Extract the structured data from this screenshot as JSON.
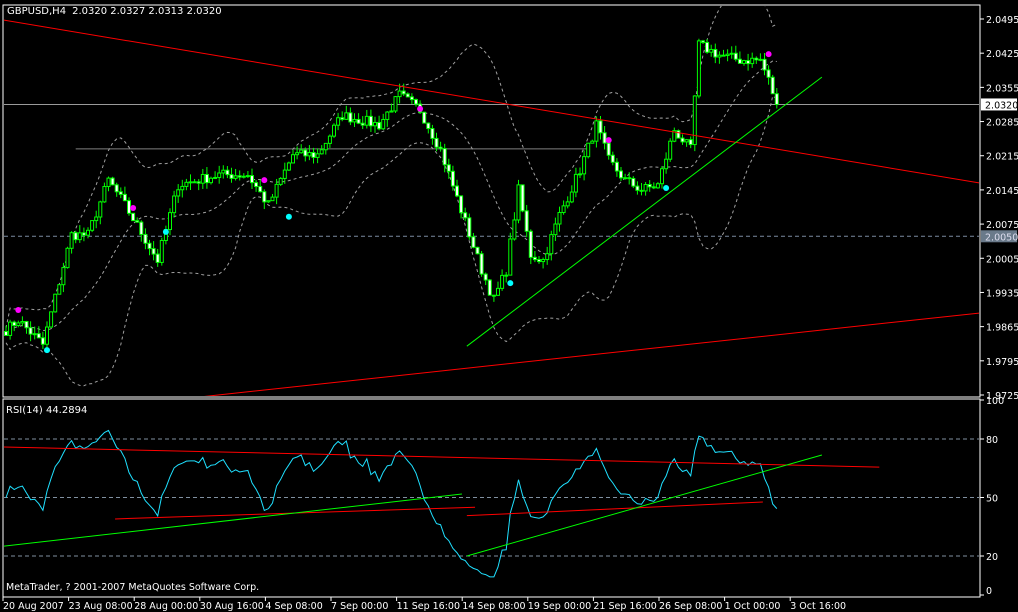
{
  "header": {
    "symbol": "GBPUSD,H4",
    "ohlc": "2.0320 2.0327 2.0313 2.0320"
  },
  "rsi_label": "RSI(14) 44.2894",
  "copyright": "MetaTrader, ? 2001-2007 MetaQuotes Software Corp.",
  "colors": {
    "background": "#000000",
    "candle": "#00ff00",
    "bear_body": "#ffffff",
    "band": "#a0a0a0",
    "trend_red": "#ff0000",
    "trend_green": "#00ff00",
    "rsi": "#1fe0ff",
    "fractal_up": "#ff00ff",
    "fractal_down": "#00ffff",
    "grid": "#8090a0"
  },
  "chart_data": [
    {
      "type": "candlestick",
      "title": "GBPUSD,H4",
      "bar_count": 189,
      "ylim": [
        1.9725,
        2.0495
      ],
      "y_ticks": [
        "2.0495",
        "2.0425",
        "2.0355",
        "2.0285",
        "2.0215",
        "2.0145",
        "2.0075",
        "2.0005",
        "1.9935",
        "1.9865",
        "1.9795",
        "1.9725"
      ],
      "current_price": "2.0320",
      "marked_level": "2.0050",
      "x_labels": [
        "20 Aug 2007",
        "23 Aug 08:00",
        "28 Aug 00:00",
        "30 Aug 16:00",
        "4 Sep 08:00",
        "7 Sep 00:00",
        "11 Sep 16:00",
        "14 Sep 08:00",
        "19 Sep 00:00",
        "21 Sep 16:00",
        "26 Sep 08:00",
        "1 Oct 00:00",
        "3 Oct 16:00"
      ],
      "x_label_bar_step": 16,
      "close_path": [
        [
          0,
          1.9858
        ],
        [
          3,
          1.9879
        ],
        [
          9,
          1.9828
        ],
        [
          16,
          2.0053
        ],
        [
          20,
          2.0053
        ],
        [
          25,
          2.0165
        ],
        [
          29,
          2.0114
        ],
        [
          37,
          2.0001
        ],
        [
          42,
          2.0155
        ],
        [
          52,
          2.0176
        ],
        [
          59,
          2.0176
        ],
        [
          64,
          2.0114
        ],
        [
          70,
          2.0217
        ],
        [
          76,
          2.0217
        ],
        [
          82,
          2.0298
        ],
        [
          91,
          2.0278
        ],
        [
          96,
          2.0339
        ],
        [
          101,
          2.0309
        ],
        [
          106,
          2.0227
        ],
        [
          111,
          2.0104
        ],
        [
          116,
          1.9981
        ],
        [
          119,
          1.992
        ],
        [
          122,
          1.9981
        ],
        [
          125,
          2.0145
        ],
        [
          128,
          2.0012
        ],
        [
          131,
          2.0001
        ],
        [
          135,
          2.0094
        ],
        [
          140,
          2.0186
        ],
        [
          144,
          2.0278
        ],
        [
          147,
          2.0206
        ],
        [
          151,
          2.0165
        ],
        [
          155,
          2.0145
        ],
        [
          159,
          2.0155
        ],
        [
          163,
          2.0268
        ],
        [
          167,
          2.0227
        ],
        [
          169,
          2.0442
        ],
        [
          174,
          2.0421
        ],
        [
          179,
          2.0411
        ],
        [
          184,
          2.0411
        ],
        [
          186,
          2.037
        ],
        [
          188,
          2.032
        ]
      ],
      "bollinger": {
        "period": 20,
        "deviations": 2
      },
      "fractals_up": [
        [
          3,
          1.9899
        ],
        [
          31,
          2.0108
        ],
        [
          63,
          2.0165
        ],
        [
          101,
          2.0311
        ],
        [
          147,
          2.0247
        ],
        [
          186,
          2.0423
        ]
      ],
      "fractals_down": [
        [
          10,
          1.9817
        ],
        [
          39,
          2.0059
        ],
        [
          69,
          2.009
        ],
        [
          123,
          1.9954
        ],
        [
          161,
          2.0149
        ]
      ],
      "trendlines": [
        {
          "color": "red",
          "from": [
            -0.7,
            2.0493
          ],
          "to": [
            237.6,
            2.0159
          ]
        },
        {
          "color": "red",
          "from": [
            47.3,
            1.9721
          ],
          "to": [
            237.6,
            1.9893
          ]
        },
        {
          "color": "green",
          "from": [
            112.4,
            1.9825
          ],
          "to": [
            199,
            2.0376
          ]
        }
      ],
      "hline_segment": {
        "from_bar": 17,
        "to_bar": 142,
        "price": 2.0229
      }
    },
    {
      "type": "line",
      "title": "RSI(14)",
      "last_value": 44.2894,
      "ylim": [
        0,
        100
      ],
      "y_ticks": [
        "100",
        "80",
        "50",
        "20",
        "0"
      ],
      "levels": [
        80,
        50,
        20
      ],
      "trendlines": [
        {
          "color": "red",
          "from": [
            -0.7,
            75.9
          ],
          "to": [
            213,
            65.6
          ]
        },
        {
          "color": "red",
          "from": [
            26.6,
            39
          ],
          "to": [
            114.4,
            45
          ]
        },
        {
          "color": "green",
          "from": [
            -0.7,
            25
          ],
          "to": [
            111.2,
            51.8
          ]
        },
        {
          "color": "red",
          "from": [
            112.4,
            40.7
          ],
          "to": [
            184.6,
            47.7
          ]
        },
        {
          "color": "green",
          "from": [
            112.4,
            20
          ],
          "to": [
            199,
            71.8
          ]
        }
      ]
    }
  ]
}
